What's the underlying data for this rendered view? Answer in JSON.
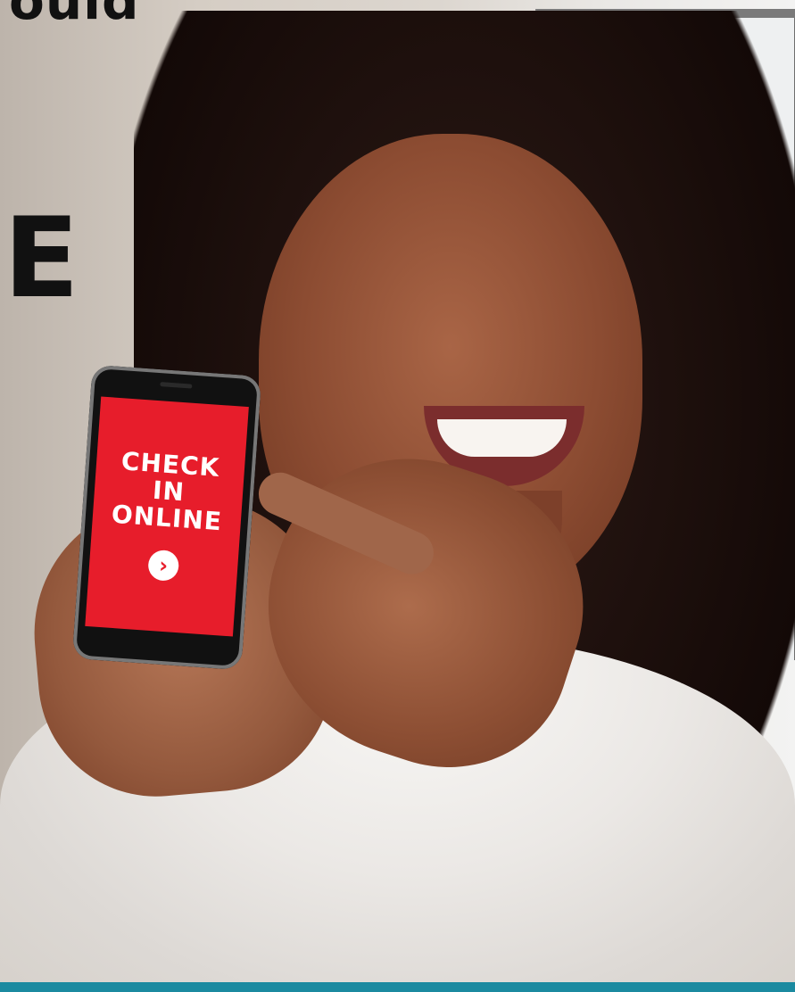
{
  "overlay_text": {
    "top_partial": "ould",
    "large_letter": "E"
  },
  "phone": {
    "lines": [
      "CHECK",
      "IN",
      "ONLINE"
    ],
    "arrow_symbol": "›"
  },
  "colors": {
    "phone_red": "#e71d2b",
    "accent_bar": "#1b8aa0",
    "text_black": "#111111"
  },
  "icons": {
    "arrow": "chevron-right-circle-icon"
  }
}
